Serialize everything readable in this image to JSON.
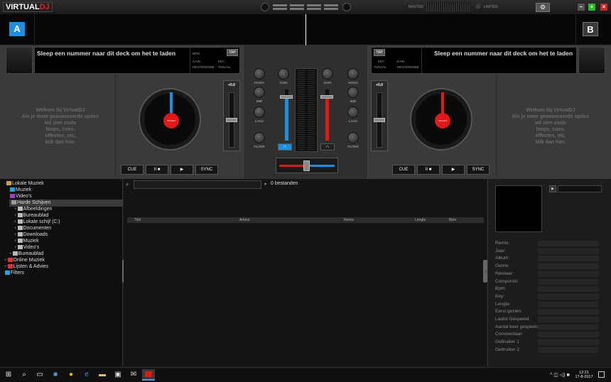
{
  "app": {
    "logo_virtual": "VIRTUAL",
    "logo_dj": "DJ",
    "master_label": "MASTER",
    "limiter_label": "LIMITER",
    "settings_icon": "gear-icon",
    "min_label": "–",
    "max_label": "+",
    "close_label": "×"
  },
  "colors": {
    "deck_a": "#1e8fe0",
    "deck_b": "#e01818",
    "accent": "#1e8fe0",
    "win_min": "#2e8b2e",
    "win_max": "#2eb82e",
    "win_close": "#c62828"
  },
  "deck_a": {
    "letter": "A",
    "title": "Sleep een nummer naar dit deck om het te laden",
    "tap": "TAP",
    "bpm": "BPM",
    "gain": "GAIN",
    "key": "KEY",
    "remaining": "RESTERENDE",
    "tonal": "TONAAL",
    "welcome": "Welkom bij VirtualDJ\nAls je meer geavanceerde opties\nwil zien zoals\nloops, cues,\neffecten, etc,\nklik dan hier.",
    "pitch": "+0.0",
    "cue": "CUE",
    "play_pause": "II ■",
    "play": "▶",
    "sync": "SYNC"
  },
  "deck_b": {
    "letter": "B",
    "title": "Sleep een nummer naar dit deck om het te laden",
    "tap": "TAP",
    "bpm": "BPM",
    "gain": "GAIN",
    "key": "KEY",
    "remaining": "RESTERENDE",
    "tonal": "TONAAL",
    "welcome": "Welkom bij VirtualDJ\nAls je meer geavanceerde opties\nwil zien zoals\nloops, cues,\neffecten, etc,\nklik dan hier.",
    "pitch": "+0.0",
    "cue": "CUE",
    "play_pause": "II ■",
    "play": "▶",
    "sync": "SYNC"
  },
  "mixer": {
    "hoog": "HOOG",
    "mid": "MID",
    "laag": "LAAG",
    "filter": "FILTER",
    "gain": "GAIN"
  },
  "browser": {
    "tree": [
      {
        "label": "Lokale Muziek",
        "indent": 0,
        "prefix": "-",
        "color": "#c9a24a"
      },
      {
        "label": "Muziek",
        "indent": 1,
        "prefix": "",
        "color": "#2aa2e0"
      },
      {
        "label": "Video's",
        "indent": 1,
        "prefix": "",
        "color": "#a040c0"
      },
      {
        "label": "Harde Schijven",
        "indent": 1,
        "prefix": "-",
        "color": "#999",
        "selected": true
      },
      {
        "label": "Afbeeldingen",
        "indent": 2,
        "prefix": "+",
        "color": "#bbb"
      },
      {
        "label": "Bureaublad",
        "indent": 2,
        "prefix": "+",
        "color": "#bbb"
      },
      {
        "label": "Lokale schijf (C:)",
        "indent": 2,
        "prefix": "+",
        "color": "#bbb"
      },
      {
        "label": "Documenten",
        "indent": 2,
        "prefix": "+",
        "color": "#bbb"
      },
      {
        "label": "Downloads",
        "indent": 2,
        "prefix": "+",
        "color": "#bbb"
      },
      {
        "label": "Muziek",
        "indent": 2,
        "prefix": "+",
        "color": "#bbb"
      },
      {
        "label": "Video's",
        "indent": 2,
        "prefix": "+",
        "color": "#bbb"
      },
      {
        "label": "Bureaublad",
        "indent": 1,
        "prefix": "+",
        "color": "#bbb"
      },
      {
        "label": "Online Muziek",
        "indent": 0,
        "prefix": "+",
        "color": "#e03030"
      },
      {
        "label": "Lijsten & Advies",
        "indent": 0,
        "prefix": "+",
        "color": "#e03030"
      },
      {
        "label": "Filters",
        "indent": 0,
        "prefix": "",
        "color": "#2aa2e0"
      }
    ],
    "search_placeholder": "",
    "file_count": "0 bestanden",
    "columns": [
      "Titel",
      "Artiest",
      "Remix",
      "Lengte",
      "Bpm"
    ],
    "left_tab": "folders",
    "right_tab": "info"
  },
  "info": {
    "fields": [
      "Remix:",
      "Jaar:",
      "Album:",
      "Genre:",
      "Remixer:",
      "Componist:",
      "Bpm:",
      "Key:",
      "Lengte:",
      "Eerst gezien:",
      "Laatst Gespeeld:",
      "Aantal keer gespeeld:",
      "Commentaar:",
      "Gebruiker 1",
      "Gebruiker 2"
    ]
  },
  "taskbar": {
    "time": "12:21",
    "date": "17-8-2017",
    "icons": [
      "windows-icon",
      "search-icon",
      "task-view-icon",
      "save-icon",
      "chrome-icon",
      "edge-icon",
      "explorer-icon",
      "store-icon",
      "mail-icon",
      "virtualdj-icon"
    ]
  }
}
